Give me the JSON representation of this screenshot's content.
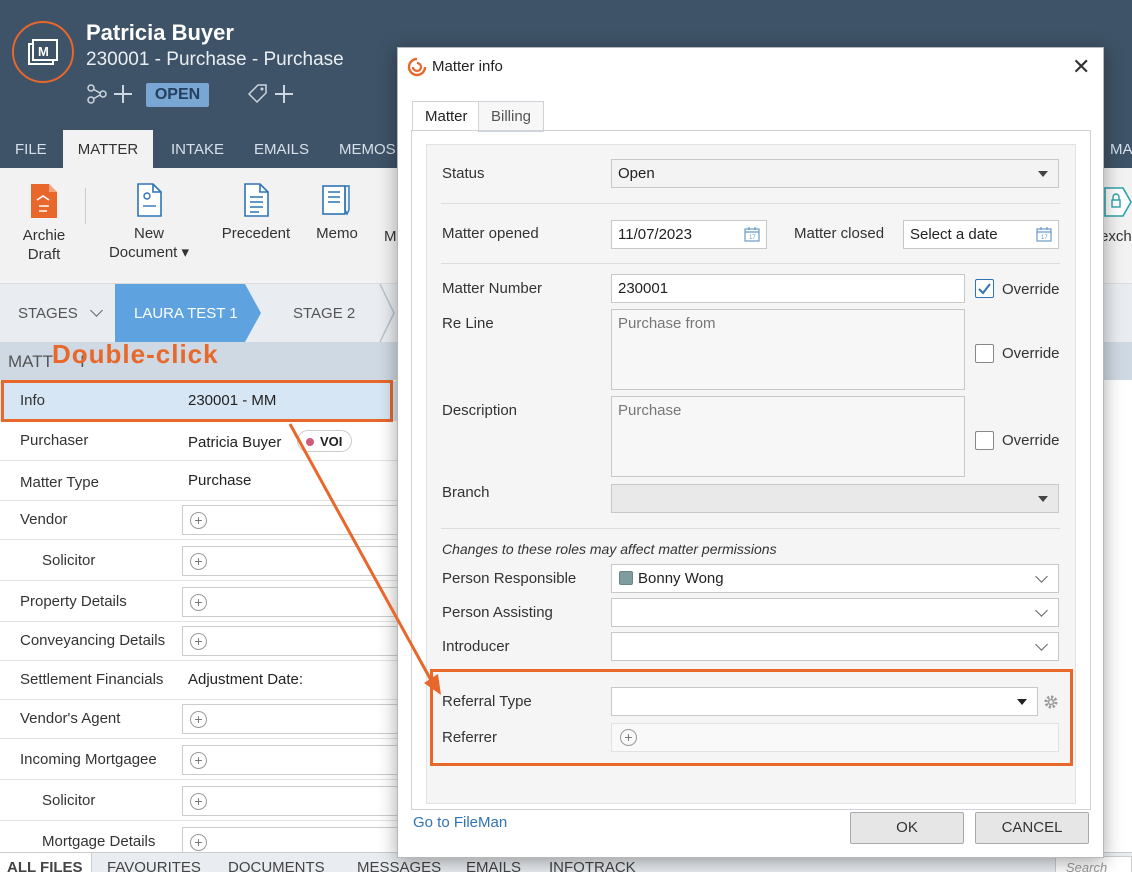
{
  "header": {
    "client_name": "Patricia Buyer",
    "subtitle": "230001 - Purchase - Purchase",
    "status": "OPEN"
  },
  "ribbon_tabs": [
    "FILE",
    "MATTER",
    "INTAKE",
    "EMAILS",
    "MEMOS",
    "MA"
  ],
  "toolbar": {
    "archie_draft": [
      "Archie",
      "Draft"
    ],
    "new_document": [
      "New",
      "Document ▾"
    ],
    "precedent": "Precedent",
    "memo": "Memo",
    "m_partial": "M",
    "exch_partial": "exch"
  },
  "stages": {
    "stages_label": "STAGES",
    "active": "LAURA TEST 1",
    "next": "STAGE 2"
  },
  "matter_section": {
    "heading": "MATT",
    "heading_partial": "I"
  },
  "annotation": {
    "text": "Double-click"
  },
  "rows": [
    {
      "label": "Info",
      "value": "230001 - MM"
    },
    {
      "label": "Purchaser",
      "value": "Patricia Buyer",
      "badge": "VOI"
    },
    {
      "label": "Matter Type",
      "value": "Purchase"
    },
    {
      "label": "Vendor"
    },
    {
      "label": "Solicitor"
    },
    {
      "label": "Property Details"
    },
    {
      "label": "Conveyancing Details"
    },
    {
      "label": "Settlement Financials",
      "value": "Adjustment Date:"
    },
    {
      "label": "Vendor's Agent"
    },
    {
      "label": "Incoming Mortgagee"
    },
    {
      "label": "Solicitor"
    },
    {
      "label": "Mortgage Details"
    }
  ],
  "bottom_tabs": [
    "ALL FILES",
    "FAVOURITES",
    "DOCUMENTS",
    "MESSAGES",
    "EMAILS",
    "INFOTRACK"
  ],
  "bottom_search": "Search",
  "modal": {
    "title": "Matter info",
    "tabs": [
      "Matter",
      "Billing"
    ],
    "status_label": "Status",
    "status_value": "Open",
    "opened_label": "Matter opened",
    "opened_value": "11/07/2023",
    "closed_label": "Matter closed",
    "closed_placeholder": "Select a date",
    "number_label": "Matter Number",
    "number_value": "230001",
    "override": "Override",
    "reline_label": "Re Line",
    "reline_placeholder": "Purchase from",
    "desc_label": "Description",
    "desc_placeholder": "Purchase",
    "branch_label": "Branch",
    "roles_note": "Changes to these roles may affect matter permissions",
    "responsible_label": "Person Responsible",
    "responsible_value": "Bonny Wong",
    "assisting_label": "Person Assisting",
    "introducer_label": "Introducer",
    "referral_type_label": "Referral Type",
    "referrer_label": "Referrer",
    "fileman_link": "Go to FileMan",
    "ok": "OK",
    "cancel": "CANCEL"
  },
  "colors": {
    "header": "#3e5367",
    "accent_orange": "#e8672a",
    "link": "#2f74b5",
    "check": "#2f74b5"
  }
}
